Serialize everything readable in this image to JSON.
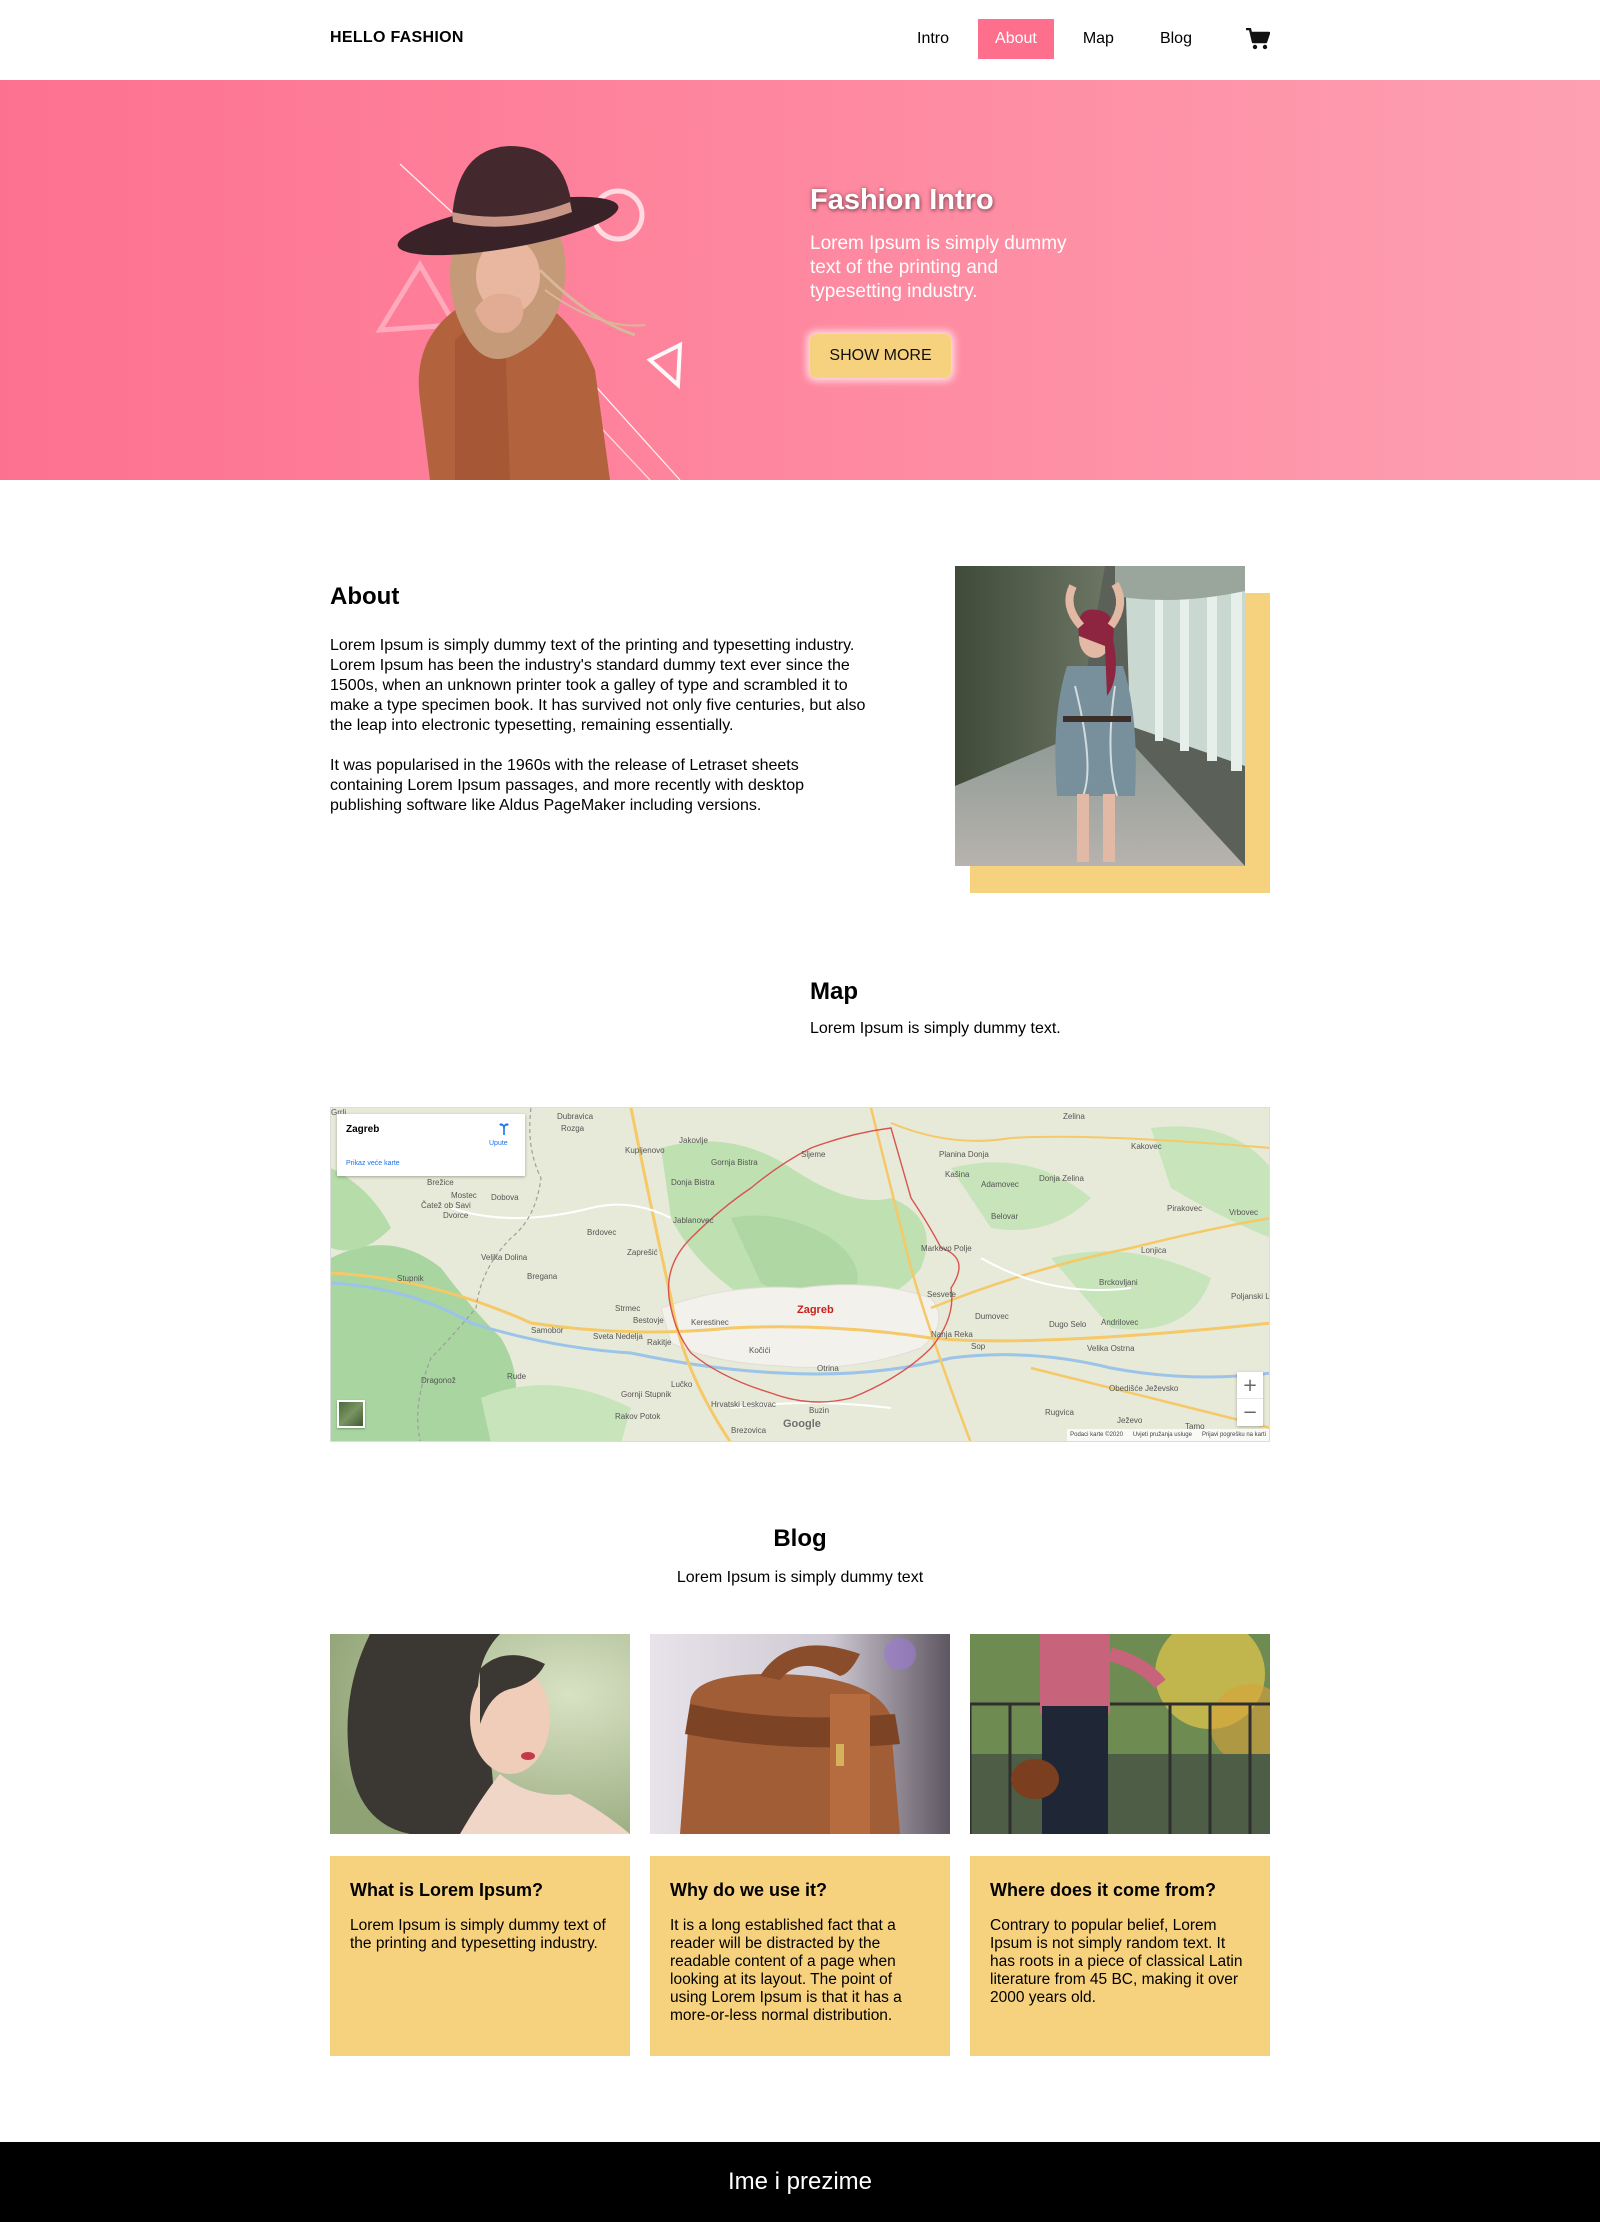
{
  "header": {
    "brand": "HELLO FASHION",
    "nav": [
      {
        "label": "Intro",
        "active": false
      },
      {
        "label": "About",
        "active": true
      },
      {
        "label": "Map",
        "active": false
      },
      {
        "label": "Blog",
        "active": false
      }
    ],
    "cart_icon": "shopping-cart-icon"
  },
  "hero": {
    "title": "Fashion Intro",
    "text": "Lorem Ipsum is simply dummy text of the printing and typesetting industry.",
    "button": "SHOW MORE"
  },
  "about": {
    "title": "About",
    "p1": "Lorem Ipsum is simply dummy text of the printing and typesetting industry. Lorem Ipsum has been the industry's standard dummy text ever since the 1500s, when an unknown printer took a galley of type and scrambled it to make a type specimen book. It has survived not only five centuries, but also the leap into electronic typesetting, remaining essentially.",
    "p2": "It was popularised in the 1960s with the release of Letraset sheets containing Lorem Ipsum passages, and more recently with desktop publishing software like Aldus PageMaker including versions."
  },
  "map_section": {
    "title": "Map",
    "subtitle": "Lorem Ipsum is simply dummy text.",
    "card": {
      "city": "Zagreb",
      "directions": "Upute",
      "larger_map": "Prikaz veće karte"
    },
    "main_label": "Zagreb",
    "places": [
      "Dubravica",
      "Rozga",
      "Jakovlje",
      "Kupljenovo",
      "Gornja Bistra",
      "Donja Bistra",
      "Bregana",
      "Čatež ob Savi",
      "Dvorce",
      "Brežice",
      "Mostec",
      "Dobova",
      "Jablanovec",
      "Brdovec",
      "Zaprešić",
      "Velika Dolina",
      "Stupnik",
      "Samobor",
      "Strmec",
      "Bestovje",
      "Sveta Nedelja",
      "Rakitje",
      "Kerestinec",
      "Kočići",
      "Lučko",
      "Hrvatski Leskovac",
      "Gornji Stupnik",
      "Rakov Potok",
      "Brezovica",
      "Rude",
      "Dragonož",
      "Sesvete",
      "Dumovec",
      "Markovo Polje",
      "Belovar",
      "Kašina",
      "Adamovec",
      "Planina Donja",
      "Sljeme",
      "Dugo Selo",
      "Andrilovec",
      "Velika Ostrna",
      "Brckovljani",
      "Lonjica",
      "Vrbovec",
      "Kakovec",
      "Zelina",
      "Donja Zelina",
      "Pirakovec",
      "Poljanski Lug",
      "Obedišće Ježevsko",
      "Rugvica",
      "Ježevo",
      "Tamo",
      "Sop",
      "Nanja Reka",
      "Buzin",
      "Otrina",
      "Grrli"
    ],
    "zoom_in": "+",
    "zoom_out": "−",
    "google": "Google",
    "attribution": [
      "Podaci karte ©2020",
      "Uvjeti pružanja usluge",
      "Prijavi pogrešku na karti"
    ]
  },
  "blog": {
    "title": "Blog",
    "subtitle": "Lorem Ipsum is simply dummy text",
    "posts": [
      {
        "title": "What is Lorem Ipsum?",
        "text": "Lorem Ipsum is simply dummy text of the printing and typesetting industry."
      },
      {
        "title": "Why do we use it?",
        "text": "It is a long established fact that a reader will be distracted by the readable content of a page when looking at its layout. The point of using Lorem Ipsum is that it has a more-or-less normal distribution."
      },
      {
        "title": "Where does it come from?",
        "text": "Contrary to popular belief, Lorem Ipsum is not simply random text. It has roots in a piece of classical Latin literature from 45 BC, making it over 2000 years old."
      }
    ]
  },
  "footer": {
    "text": "Ime i prezime"
  },
  "colors": {
    "accent_pink": "#fe6f8d",
    "accent_yellow": "#f7d27e",
    "footer_bg": "#000000"
  }
}
